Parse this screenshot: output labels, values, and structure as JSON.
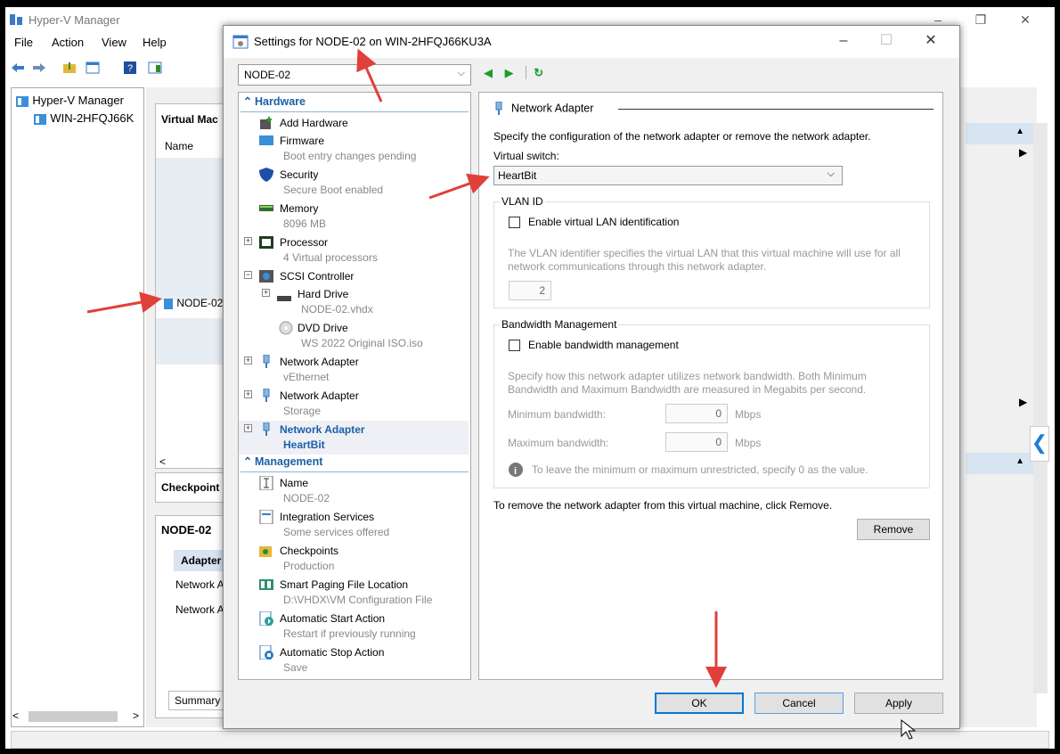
{
  "main": {
    "title": "Hyper-V Manager",
    "menu": [
      "File",
      "Action",
      "View",
      "Help"
    ],
    "tree": {
      "root": "Hyper-V Manager",
      "host": "WIN-2HFQJ66K"
    },
    "center": {
      "vm_header": "Virtual Mac",
      "name_col": "Name",
      "vm_row": "NODE-02",
      "checkpoints": "Checkpoint",
      "detail_title": "NODE-02",
      "adapter_tab": "Adapter",
      "net1": "Network Ad",
      "net2": "Network Ad",
      "summary_tab": "Summary"
    }
  },
  "dialog": {
    "title": "Settings for NODE-02 on WIN-2HFQJ66KU3A",
    "vm_select": "NODE-02",
    "sections": {
      "hardware": "Hardware",
      "management": "Management"
    },
    "hardware_items": [
      {
        "name": "Add Hardware",
        "sub": ""
      },
      {
        "name": "Firmware",
        "sub": "Boot entry changes pending"
      },
      {
        "name": "Security",
        "sub": "Secure Boot enabled"
      },
      {
        "name": "Memory",
        "sub": "8096 MB"
      },
      {
        "name": "Processor",
        "sub": "4 Virtual processors"
      },
      {
        "name": "SCSI Controller",
        "sub": ""
      },
      {
        "name": "Hard Drive",
        "sub": "NODE-02.vhdx"
      },
      {
        "name": "DVD Drive",
        "sub": "WS 2022 Original ISO.iso"
      },
      {
        "name": "Network Adapter",
        "sub": "vEthernet"
      },
      {
        "name": "Network Adapter",
        "sub": "Storage"
      },
      {
        "name": "Network Adapter",
        "sub": "HeartBit"
      }
    ],
    "management_items": [
      {
        "name": "Name",
        "sub": "NODE-02"
      },
      {
        "name": "Integration Services",
        "sub": "Some services offered"
      },
      {
        "name": "Checkpoints",
        "sub": "Production"
      },
      {
        "name": "Smart Paging File Location",
        "sub": "D:\\VHDX\\VM Configuration File"
      },
      {
        "name": "Automatic Start Action",
        "sub": "Restart if previously running"
      },
      {
        "name": "Automatic Stop Action",
        "sub": "Save"
      }
    ],
    "panel": {
      "heading": "Network Adapter",
      "intro": "Specify the configuration of the network adapter or remove the network adapter.",
      "vswitch_label": "Virtual switch:",
      "vswitch_value": "HeartBit",
      "vlan_group": "VLAN ID",
      "vlan_checkbox": "Enable virtual LAN identification",
      "vlan_desc1": "The VLAN identifier specifies the virtual LAN that this virtual machine will use for all",
      "vlan_desc2": "network communications through this network adapter.",
      "vlan_value": "2",
      "bw_group": "Bandwidth Management",
      "bw_checkbox": "Enable bandwidth management",
      "bw_desc1": "Specify how this network adapter utilizes network bandwidth. Both Minimum",
      "bw_desc2": "Bandwidth and Maximum Bandwidth are measured in Megabits per second.",
      "min_label": "Minimum bandwidth:",
      "min_value": "0",
      "max_label": "Maximum bandwidth:",
      "max_value": "0",
      "unit": "Mbps",
      "info": "To leave the minimum or maximum unrestricted, specify 0 as the value.",
      "remove_text": "To remove the network adapter from this virtual machine, click Remove.",
      "remove_btn": "Remove"
    },
    "buttons": {
      "ok": "OK",
      "cancel": "Cancel",
      "apply": "Apply"
    }
  },
  "colors": {
    "accent": "#1c5fa8",
    "annotation_arrow": "#e0403a"
  }
}
